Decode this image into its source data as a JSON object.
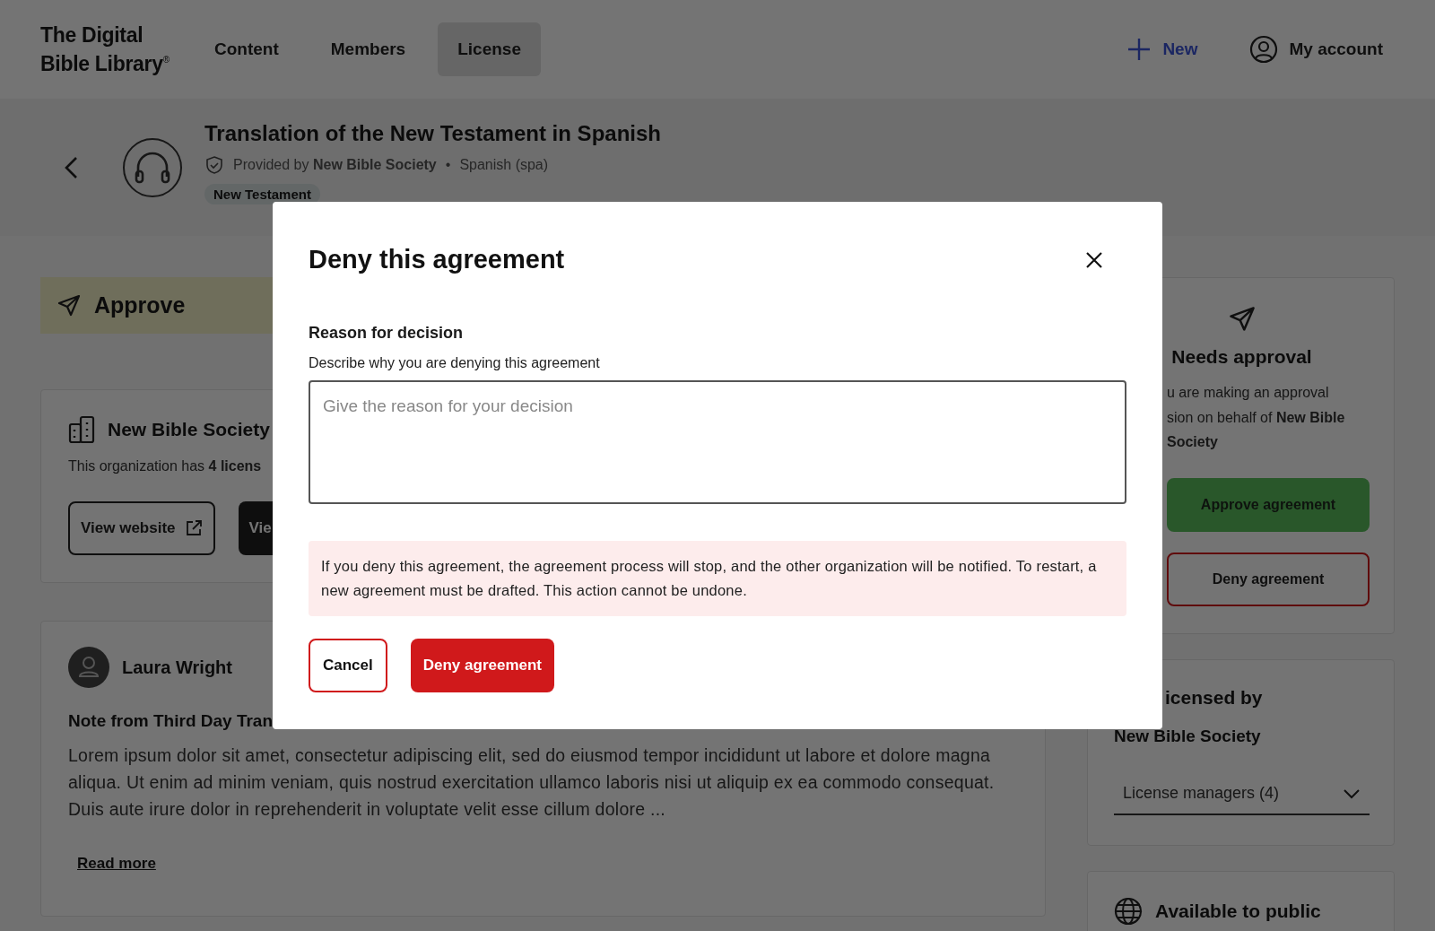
{
  "header": {
    "logo_lines": [
      "The Digital",
      "Bible Library$^{®}$"
    ],
    "nav": [
      {
        "label": "Content",
        "selected": false
      },
      {
        "label": "Members",
        "selected": false
      },
      {
        "label": "License",
        "selected": true
      }
    ],
    "new_label": "New",
    "account_label": "My account"
  },
  "resource": {
    "title": "Translation of the New Testament in Spanish",
    "provided": "Provided by **New Bible Society**",
    "separator": "•",
    "language": "Spanish (spa)",
    "tag": "New Testament"
  },
  "banner": {
    "label": "Approve"
  },
  "organization": {
    "name": "New Bible Society",
    "summary": "This organization has **4 licens**",
    "buttons": [
      {
        "label": "View website",
        "kind": "outline"
      },
      {
        "label": "Vie",
        "kind": "dark"
      }
    ]
  },
  "note": {
    "author": "Laura Wright",
    "heading": "Note from Third Day Tran",
    "body": "Lorem ipsum dolor sit amet, consectetur adipiscing elit, sed do eiusmod tempor incididunt ut labore et dolore magna aliqua. Ut enim ad minim veniam, quis nostrud exercitation ullamco laboris nisi ut aliquip ex ea commodo consequat. Duis aute irure dolor in reprehenderit in voluptate velit esse cillum dolore ...",
    "link": "Read more"
  },
  "approval_card": {
    "title": "Needs approval",
    "lines": [
      "u are making an approval",
      "sion on behalf of **New Bible Society**"
    ],
    "buttons": [
      {
        "label": "Approve agreement",
        "kind": "approve"
      },
      {
        "label": "Deny agreement",
        "kind": "deny"
      }
    ]
  },
  "licensed_card": {
    "title": "icensed by",
    "organization": "New Bible Society",
    "dropdown": "License managers (4)"
  },
  "public_card": {
    "title": "Available to public"
  },
  "modal": {
    "title": "Deny this agreement",
    "label": "Reason for decision",
    "hint": "Describe why you are denying this agreement",
    "placeholder": "Give the reason for your decision",
    "warning": "If you deny this agreement, the agreement process will stop, and the other organization will be notified. To restart, a new agreement must be drafted. This action cannot be undone.",
    "buttons": [
      {
        "label": "Cancel",
        "kind": "secondary"
      },
      {
        "label": "Deny agreement",
        "kind": "danger"
      }
    ]
  }
}
